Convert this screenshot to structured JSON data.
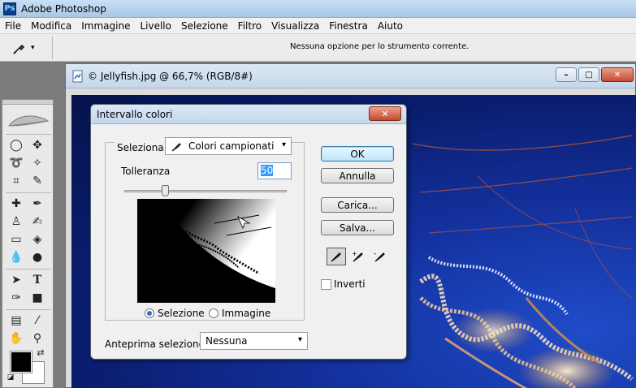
{
  "app": {
    "title": "Adobe Photoshop",
    "icon_text": "Ps"
  },
  "menu": [
    "File",
    "Modifica",
    "Immagine",
    "Livello",
    "Selezione",
    "Filtro",
    "Visualizza",
    "Finestra",
    "Aiuto"
  ],
  "options_bar": {
    "message": "Nessuna opzione per lo strumento corrente.",
    "tool_icon": "eyedropper-icon"
  },
  "document": {
    "title": "© Jellyfish.jpg @ 66,7% (RGB/8#)",
    "window_buttons": {
      "minimize": "–",
      "maximize": "□",
      "close": "✕"
    }
  },
  "dialog": {
    "title": "Intervallo colori",
    "close_glyph": "✕",
    "select_label": "Seleziona:",
    "select_value": "Colori campionati",
    "tolerance_label": "Tolleranza",
    "tolerance_value": "50",
    "tolerance_fraction": 0.25,
    "radio_selection": "Selezione",
    "radio_image": "Immagine",
    "radio_checked": "selection",
    "preview_label": "Anteprima selezione:",
    "preview_value": "Nessuna",
    "buttons": {
      "ok": "OK",
      "cancel": "Annulla",
      "load": "Carica...",
      "save": "Salva..."
    },
    "invert_label": "Inverti",
    "invert_checked": false
  },
  "colors": {
    "foreground": "#000000",
    "background": "#ffffff",
    "canvas": "#0a1d6e",
    "accent": "#3399ff"
  },
  "caret": "▾"
}
